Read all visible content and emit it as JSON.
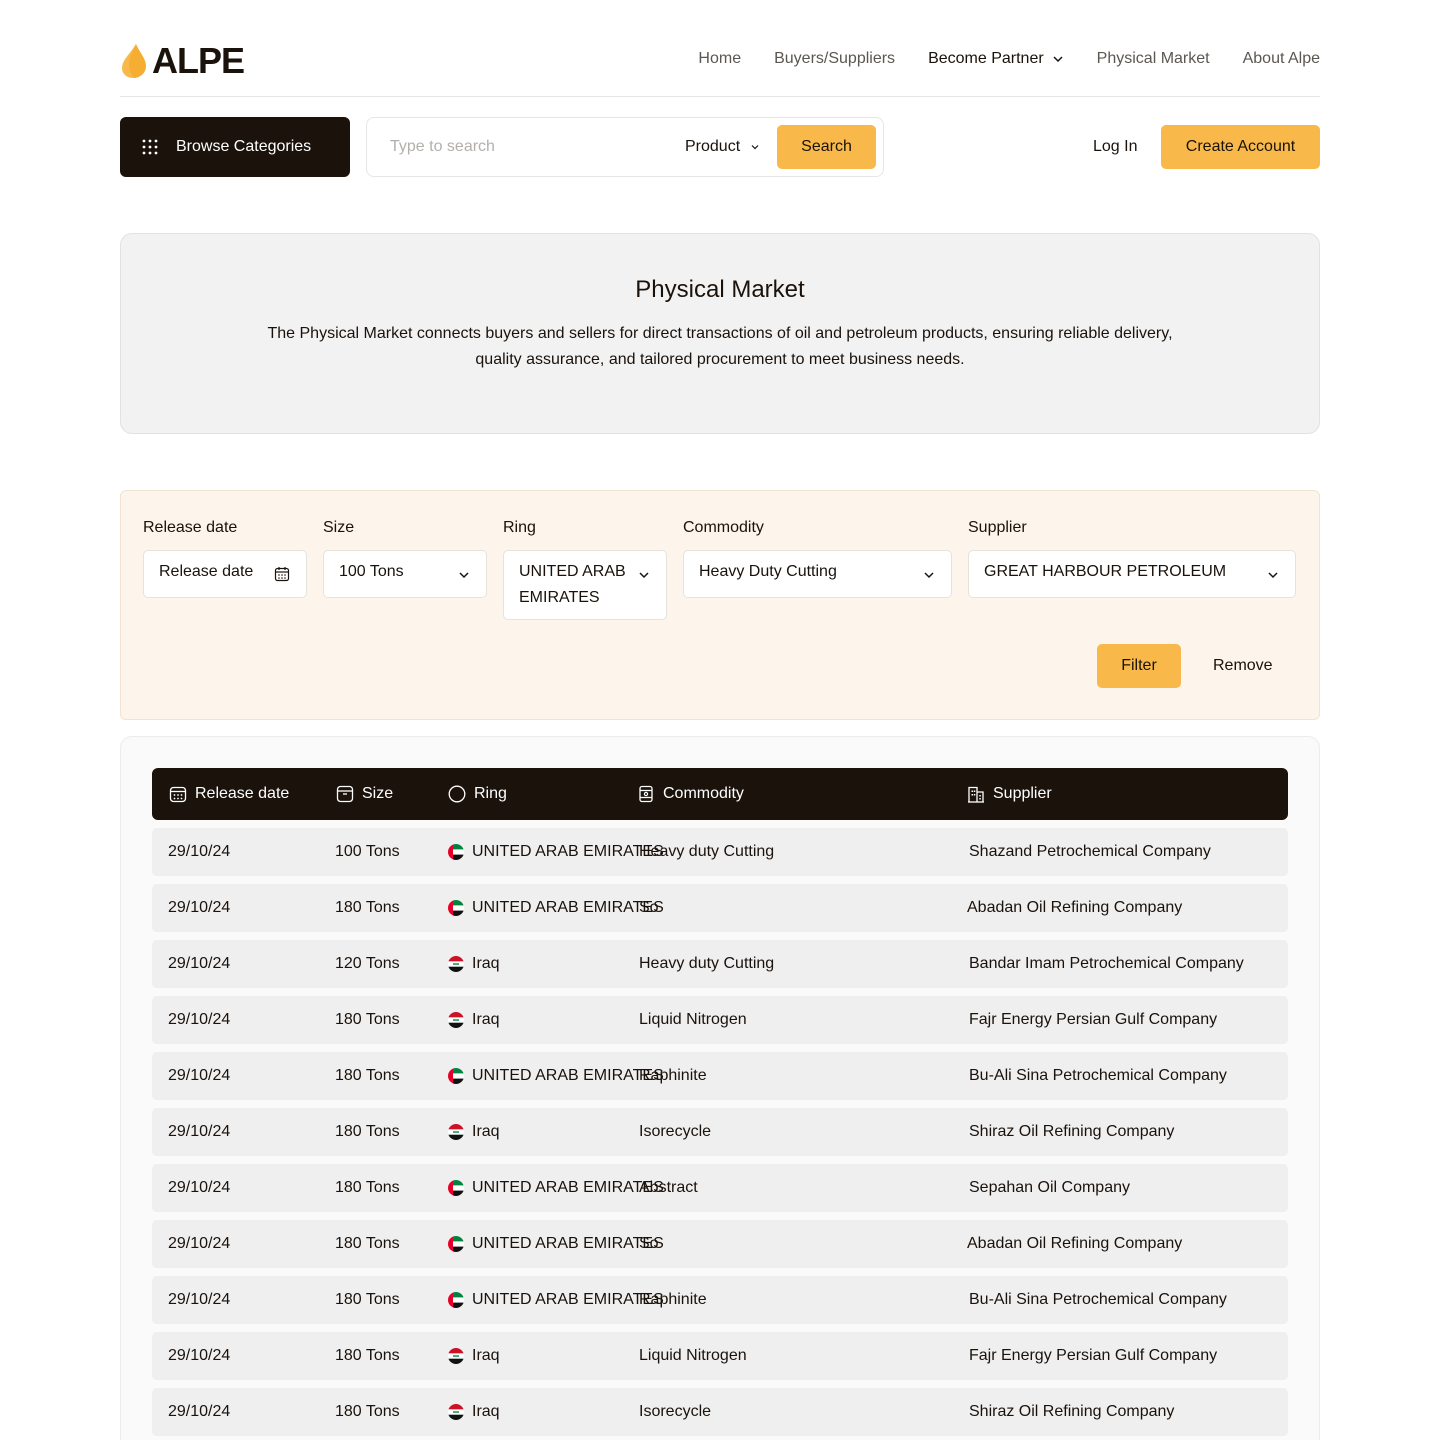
{
  "brand": {
    "name": "ALPE",
    "accent": "#f9b94a",
    "dark": "#1a120b"
  },
  "nav": {
    "items": [
      {
        "label": "Home",
        "active": false
      },
      {
        "label": "Buyers/Suppliers",
        "active": false
      },
      {
        "label": "Become Partner",
        "active": true,
        "dropdown": true
      },
      {
        "label": "Physical Market",
        "active": false
      },
      {
        "label": "About Alpe",
        "active": false
      }
    ]
  },
  "toolbar": {
    "browse_label": "Browse Categories",
    "search_placeholder": "Type to search",
    "search_scope": "Product",
    "search_label": "Search",
    "login_label": "Log In",
    "create_label": "Create Account"
  },
  "hero": {
    "title": "Physical Market",
    "description": "The Physical Market connects buyers and sellers for direct transactions of oil and petroleum products, ensuring reliable delivery, quality assurance, and tailored procurement to meet business needs."
  },
  "filters": {
    "release_date": {
      "label": "Release date",
      "value": "Release date"
    },
    "size": {
      "label": "Size",
      "value": "100 Tons"
    },
    "ring": {
      "label": "Ring",
      "value": "UNITED ARAB EMIRATES"
    },
    "commodity": {
      "label": "Commodity",
      "value": "Heavy Duty Cutting"
    },
    "supplier": {
      "label": "Supplier",
      "value": "GREAT HARBOUR PETROLEUM"
    },
    "filter_label": "Filter",
    "remove_label": "Remove"
  },
  "table": {
    "columns": [
      "Release date",
      "Size",
      "Ring",
      "Commodity",
      "Supplier"
    ],
    "rows": [
      {
        "date": "29/10/24",
        "size": "100 Tons",
        "ring": "UNITED ARAB EMIRATES",
        "flag": "uae",
        "commodity": "Heavy duty Cutting",
        "supplier": "Shazand Petrochemical Company"
      },
      {
        "date": "29/10/24",
        "size": "180 Tons",
        "ring": "UNITED ARAB EMIRATES",
        "flag": "uae",
        "commodity": "So",
        "supplier": "Abadan Oil Refining Company"
      },
      {
        "date": "29/10/24",
        "size": "120 Tons",
        "ring": "Iraq",
        "flag": "iraq",
        "commodity": "Heavy duty Cutting",
        "supplier": "Bandar Imam Petrochemical Company"
      },
      {
        "date": "29/10/24",
        "size": "180 Tons",
        "ring": "Iraq",
        "flag": "iraq",
        "commodity": "Liquid Nitrogen",
        "supplier": "Fajr Energy Persian Gulf Company"
      },
      {
        "date": "29/10/24",
        "size": "180 Tons",
        "ring": "UNITED ARAB EMIRATES",
        "flag": "uae",
        "commodity": "Raphinite",
        "supplier": "Bu-Ali Sina Petrochemical Company"
      },
      {
        "date": "29/10/24",
        "size": "180 Tons",
        "ring": "Iraq",
        "flag": "iraq",
        "commodity": "Isorecycle",
        "supplier": "Shiraz Oil Refining Company"
      },
      {
        "date": "29/10/24",
        "size": "180 Tons",
        "ring": "UNITED ARAB EMIRATES",
        "flag": "uae",
        "commodity": "Abstract",
        "supplier": "Sepahan Oil Company"
      },
      {
        "date": "29/10/24",
        "size": "180 Tons",
        "ring": "UNITED ARAB EMIRATES",
        "flag": "uae",
        "commodity": "So",
        "supplier": "Abadan Oil Refining Company"
      },
      {
        "date": "29/10/24",
        "size": "180 Tons",
        "ring": "UNITED ARAB EMIRATES",
        "flag": "uae",
        "commodity": "Raphinite",
        "supplier": "Bu-Ali Sina Petrochemical Company"
      },
      {
        "date": "29/10/24",
        "size": "180 Tons",
        "ring": "Iraq",
        "flag": "iraq",
        "commodity": "Liquid Nitrogen",
        "supplier": "Fajr Energy Persian Gulf Company"
      },
      {
        "date": "29/10/24",
        "size": "180 Tons",
        "ring": "Iraq",
        "flag": "iraq",
        "commodity": "Isorecycle",
        "supplier": "Shiraz Oil Refining Company"
      }
    ]
  }
}
